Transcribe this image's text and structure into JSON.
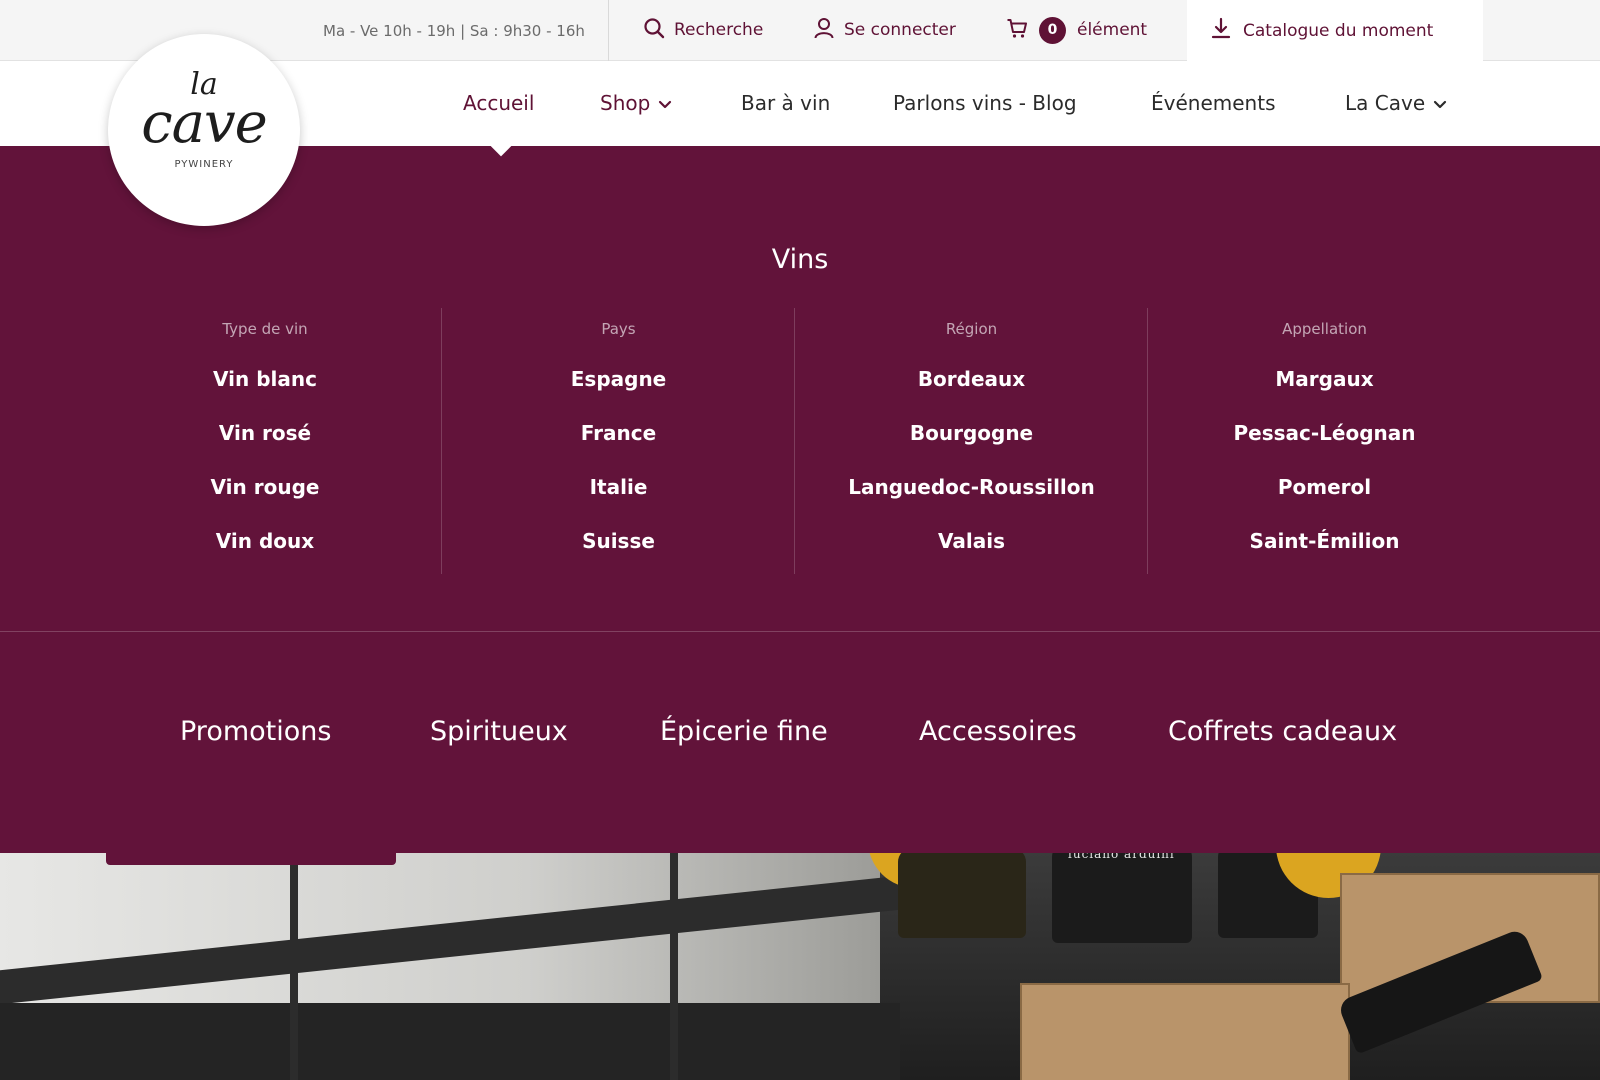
{
  "topbar": {
    "hours": "Ma - Ve 10h - 19h | Sa : 9h30 - 16h",
    "search": "Recherche",
    "login": "Se connecter",
    "cart_count": "0",
    "cart_label": "élément",
    "catalogue": "Catalogue du moment"
  },
  "logo": {
    "line1": "la",
    "line2": "cave",
    "line3": "PYWINERY"
  },
  "nav": {
    "items": [
      {
        "label": "Accueil",
        "active": true
      },
      {
        "label": "Shop",
        "dropdown": true
      },
      {
        "label": "Bar à vin"
      },
      {
        "label": "Parlons vins - Blog"
      },
      {
        "label": "Événements"
      },
      {
        "label": "La Cave",
        "dropdown": true
      }
    ]
  },
  "mega": {
    "title": "Vins",
    "columns": [
      {
        "heading": "Type de vin",
        "links": [
          "Vin blanc",
          "Vin rosé",
          "Vin rouge",
          "Vin doux"
        ]
      },
      {
        "heading": "Pays",
        "links": [
          "Espagne",
          "France",
          "Italie",
          "Suisse"
        ]
      },
      {
        "heading": "Région",
        "links": [
          "Bordeaux",
          "Bourgogne",
          "Languedoc-Roussillon",
          "Valais"
        ]
      },
      {
        "heading": "Appellation",
        "links": [
          "Margaux",
          "Pessac-Léognan",
          "Pomerol",
          "Saint-Émilion"
        ]
      }
    ],
    "categories": [
      "Promotions",
      "Spiritueux",
      "Épicerie fine",
      "Accessoires",
      "Coffrets cadeaux"
    ]
  },
  "hero": {
    "bottle_label": "luciano arduini"
  },
  "colors": {
    "brand": "#62133a",
    "accent_text": "#5f1235",
    "badge": "#dba520"
  },
  "icons": [
    "search-icon",
    "user-icon",
    "cart-icon",
    "download-icon",
    "chevron-down-icon"
  ]
}
